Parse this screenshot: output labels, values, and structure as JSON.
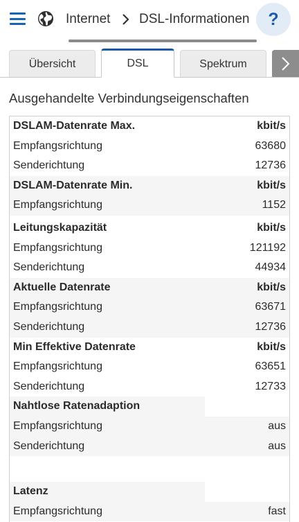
{
  "header": {
    "internet_label": "Internet",
    "title": "DSL-Informationen",
    "help_label": "?",
    "menu_icon": "hamburger-icon",
    "globe_icon": "globe-icon",
    "accent_color": "#1c5aa8"
  },
  "tabs": [
    {
      "label": "Übersicht",
      "active": false
    },
    {
      "label": "DSL",
      "active": true
    },
    {
      "label": "Spektrum",
      "active": false
    }
  ],
  "section": {
    "title": "Ausgehandelte Verbindungseigenschaften"
  },
  "table": {
    "groups": [
      {
        "title": "DSLAM-Datenrate Max.",
        "unit": "kbit/s",
        "rows": [
          {
            "label": "Empfangsrichtung",
            "value": "63680"
          },
          {
            "label": "Senderichtung",
            "value": "12736"
          }
        ]
      },
      {
        "title": "DSLAM-Datenrate Min.",
        "unit": "kbit/s",
        "rows": [
          {
            "label": "Empfangsrichtung",
            "value": "1152"
          }
        ]
      },
      {
        "title": "Leitungskapazität",
        "unit": "kbit/s",
        "rows": [
          {
            "label": "Empfangsrichtung",
            "value": "121192"
          },
          {
            "label": "Senderichtung",
            "value": "44934"
          }
        ]
      },
      {
        "title": "Aktuelle Datenrate",
        "unit": "kbit/s",
        "rows": [
          {
            "label": "Empfangsrichtung",
            "value": "63671"
          },
          {
            "label": "Senderichtung",
            "value": "12736"
          }
        ]
      },
      {
        "title": "Min Effektive Datenrate",
        "unit": "kbit/s",
        "rows": [
          {
            "label": "Empfangsrichtung",
            "value": "63651"
          },
          {
            "label": "Senderichtung",
            "value": "12733"
          }
        ]
      },
      {
        "title": "Nahtlose Ratenadaption",
        "unit": "",
        "rows": [
          {
            "label": "Empfangsrichtung",
            "value": "aus"
          },
          {
            "label": "Senderichtung",
            "value": "aus"
          }
        ]
      },
      {
        "title": "Latenz",
        "unit": "",
        "rows": [
          {
            "label": "Empfangsrichtung",
            "value": "fast"
          }
        ]
      }
    ]
  }
}
